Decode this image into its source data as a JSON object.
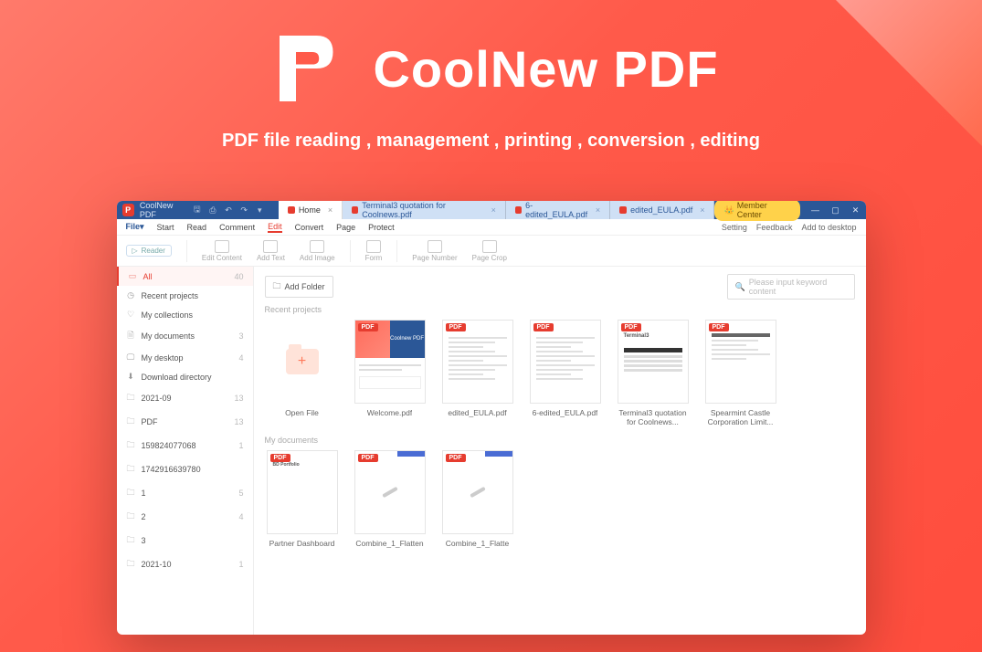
{
  "hero": {
    "title": "CoolNew PDF",
    "subtitle": "PDF file reading , management , printing , conversion , editing"
  },
  "titlebar": {
    "app_name": "CoolNew PDF",
    "tabs": [
      {
        "label": "Home",
        "active": true
      },
      {
        "label": "Terminal3 quotation for Coolnews.pdf",
        "active": false
      },
      {
        "label": "6-edited_EULA.pdf",
        "active": false
      },
      {
        "label": "edited_EULA.pdf",
        "active": false
      }
    ],
    "member_center": "Member Center"
  },
  "menu": {
    "file": "File▾",
    "items": [
      "Start",
      "Read",
      "Comment",
      "Edit",
      "Convert",
      "Page",
      "Protect"
    ],
    "active_index": 3,
    "right": [
      "Setting",
      "Feedback",
      "Add to desktop"
    ]
  },
  "ribbon": {
    "reader": "Reader",
    "groups": [
      "Edit Content",
      "Add Text",
      "Add Image",
      "Form",
      "Page Number",
      "Page Crop"
    ]
  },
  "sidebar": [
    {
      "icon": "▭",
      "label": "All",
      "count": "40",
      "active": true
    },
    {
      "icon": "◷",
      "label": "Recent projects",
      "count": ""
    },
    {
      "icon": "♡",
      "label": "My collections",
      "count": ""
    },
    {
      "icon": "🗎",
      "label": "My documents",
      "count": "3"
    },
    {
      "icon": "🖵",
      "label": "My desktop",
      "count": "4"
    },
    {
      "icon": "⬇",
      "label": "Download directory",
      "count": ""
    },
    {
      "icon": "🗀",
      "label": "2021-09",
      "count": "13"
    },
    {
      "icon": "🗀",
      "label": "PDF",
      "count": "13"
    },
    {
      "icon": "🗀",
      "label": "159824077068",
      "count": "1"
    },
    {
      "icon": "🗀",
      "label": "1742916639780",
      "count": ""
    },
    {
      "icon": "🗀",
      "label": "1",
      "count": "5"
    },
    {
      "icon": "🗀",
      "label": "2",
      "count": "4"
    },
    {
      "icon": "🗀",
      "label": "3",
      "count": ""
    },
    {
      "icon": "🗀",
      "label": "2021-10",
      "count": "1"
    }
  ],
  "main": {
    "add_folder": "Add Folder",
    "search_placeholder": "Please input keyword content",
    "section_recent": "Recent projects",
    "section_docs": "My documents",
    "open_file": "Open File",
    "recent_items": [
      {
        "name": "Welcome.pdf",
        "kind": "welcome"
      },
      {
        "name": "edited_EULA.pdf",
        "kind": "doc"
      },
      {
        "name": "6-edited_EULA.pdf",
        "kind": "doc"
      },
      {
        "name": "Terminal3 quotation for Coolnews...",
        "kind": "table",
        "header": "Terminal3"
      },
      {
        "name": "Spearmint Castle Corporation Limit...",
        "kind": "form"
      }
    ],
    "doc_items": [
      {
        "name": "Partner Dashboard",
        "kind": "dash"
      },
      {
        "name": "Combine_1_Flatten",
        "kind": "pen"
      },
      {
        "name": "Combine_1_Flatte",
        "kind": "pen"
      }
    ]
  }
}
